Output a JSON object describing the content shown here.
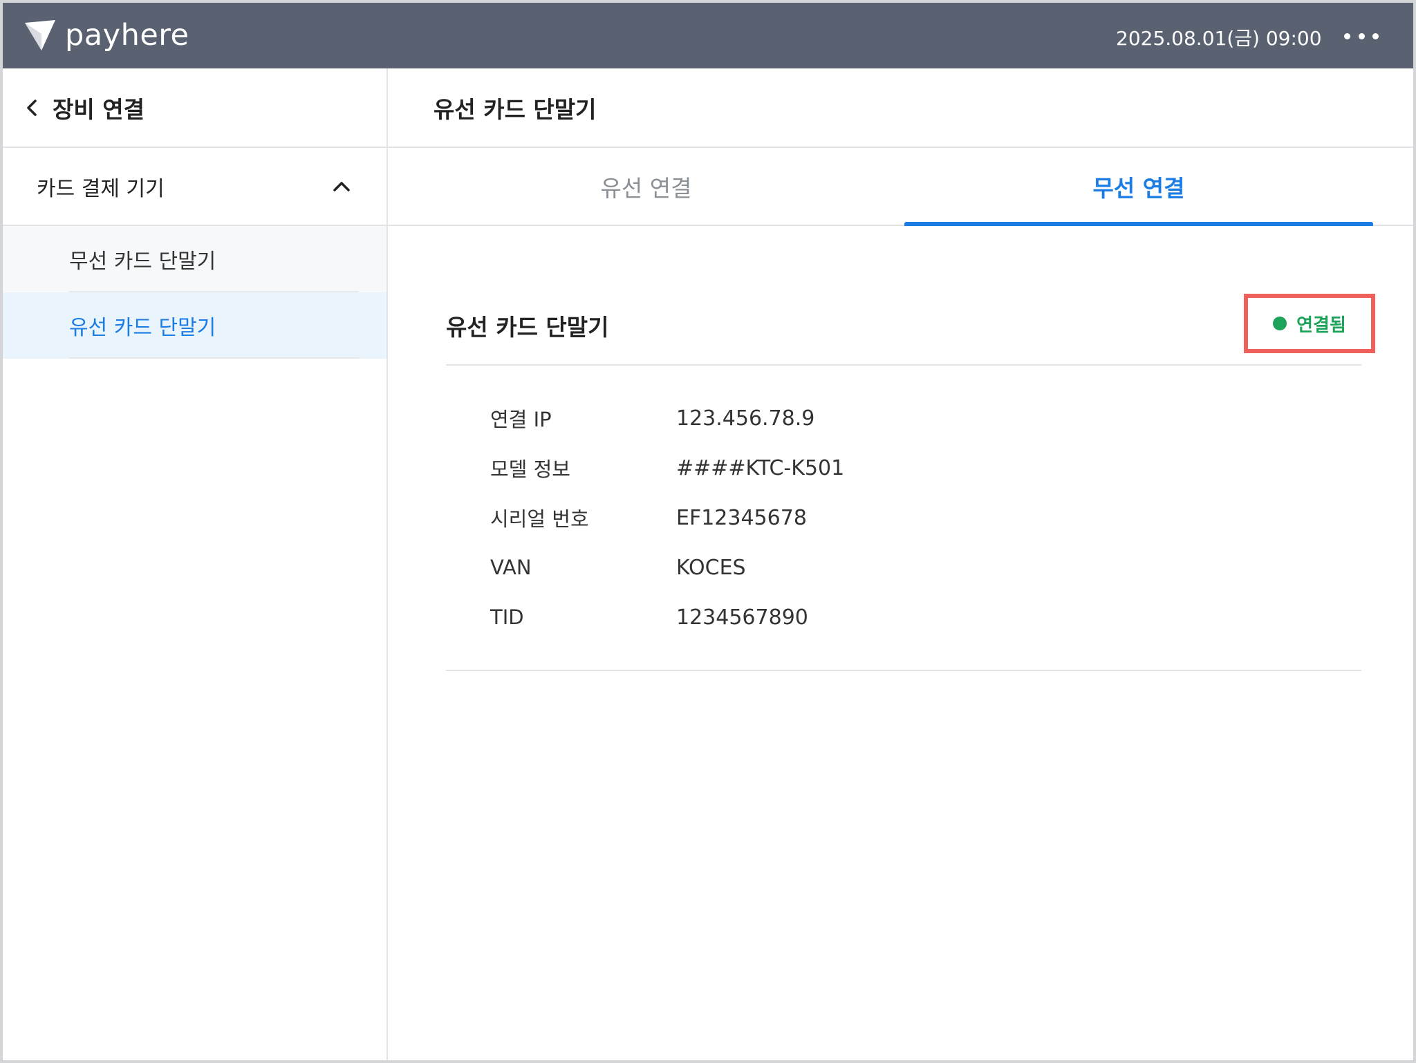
{
  "app": {
    "logo_text": "payhere",
    "datetime": "2025.08.01(금) 09:00"
  },
  "sidebar": {
    "title": "장비 연결",
    "group": {
      "label": "카드 결제 기기",
      "expanded": true,
      "items": [
        {
          "label": "무선 카드 단말기",
          "active": false
        },
        {
          "label": "유선 카드 단말기",
          "active": true
        }
      ]
    }
  },
  "main": {
    "title": "유선 카드 단말기",
    "tabs": [
      {
        "label": "유선 연결",
        "active": false
      },
      {
        "label": "무선 연결",
        "active": true
      }
    ],
    "section": {
      "title": "유선 카드 단말기",
      "status": "연결됨",
      "details": [
        {
          "label": "연결 IP",
          "value": "123.456.78.9"
        },
        {
          "label": "모델 정보",
          "value": "####KTC-K501"
        },
        {
          "label": "시리얼 번호",
          "value": "EF12345678"
        },
        {
          "label": "VAN",
          "value": "KOCES"
        },
        {
          "label": "TID",
          "value": "1234567890"
        }
      ]
    }
  },
  "colors": {
    "topbar": "#5a6170",
    "accent": "#1b7ce4",
    "status_ok": "#1ea35a",
    "highlight_box": "#f0605a"
  },
  "icons": [
    "payhere-logo-icon",
    "more-icon",
    "back-chevron-icon",
    "chevron-up-icon",
    "status-dot-icon"
  ]
}
